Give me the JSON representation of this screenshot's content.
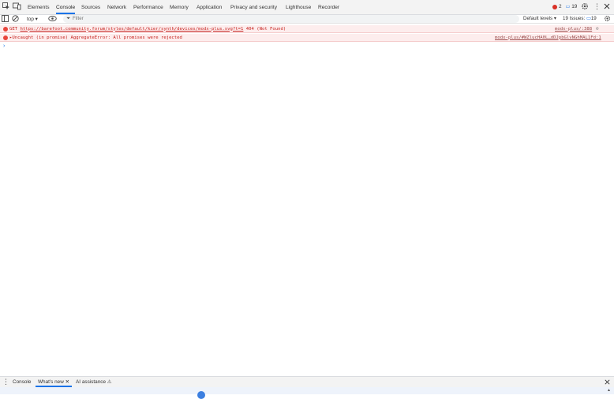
{
  "tabs": [
    {
      "label": "Elements",
      "active": false
    },
    {
      "label": "Console",
      "active": true
    },
    {
      "label": "Sources",
      "active": false
    },
    {
      "label": "Network",
      "active": false
    },
    {
      "label": "Performance",
      "active": false
    },
    {
      "label": "Memory",
      "active": false
    },
    {
      "label": "Application",
      "active": false
    },
    {
      "label": "Privacy and security",
      "active": false
    },
    {
      "label": "Lighthouse",
      "active": false
    },
    {
      "label": "Recorder",
      "active": false
    }
  ],
  "badges": {
    "errors": "2",
    "messages": "19"
  },
  "toolbar": {
    "context": "top ▾",
    "filter_placeholder": "Filter",
    "levels": "Default levels ▾",
    "issues_label": "19 Issues:",
    "issues_count": "19"
  },
  "messages": [
    {
      "level": "error",
      "prefix": "GET ",
      "url": "https://barefoot.community.forum/styles/default/kier/synth/devices/modx-plus.svg?t=1",
      "suffix": " 404 (Not Found)",
      "source": "modx-plus/:388"
    },
    {
      "level": "error",
      "prefix": "▸Uncaught (in promise) AggregateError: All promises were rejected",
      "url": "",
      "suffix": "",
      "source": "modx-plus/#WZlucHA0L…dDJpbGlvNGhMAL1Fd:1"
    }
  ],
  "prompt": "›",
  "drawer": {
    "tabs": [
      {
        "label": "Console",
        "active": false
      },
      {
        "label": "What's new ✕",
        "active": true
      },
      {
        "label": "AI assistance ⚠",
        "active": false
      }
    ]
  },
  "colors": {
    "accent": "#1a73e8",
    "error_bg": "#fdeded",
    "error_text": "#c5221f"
  }
}
